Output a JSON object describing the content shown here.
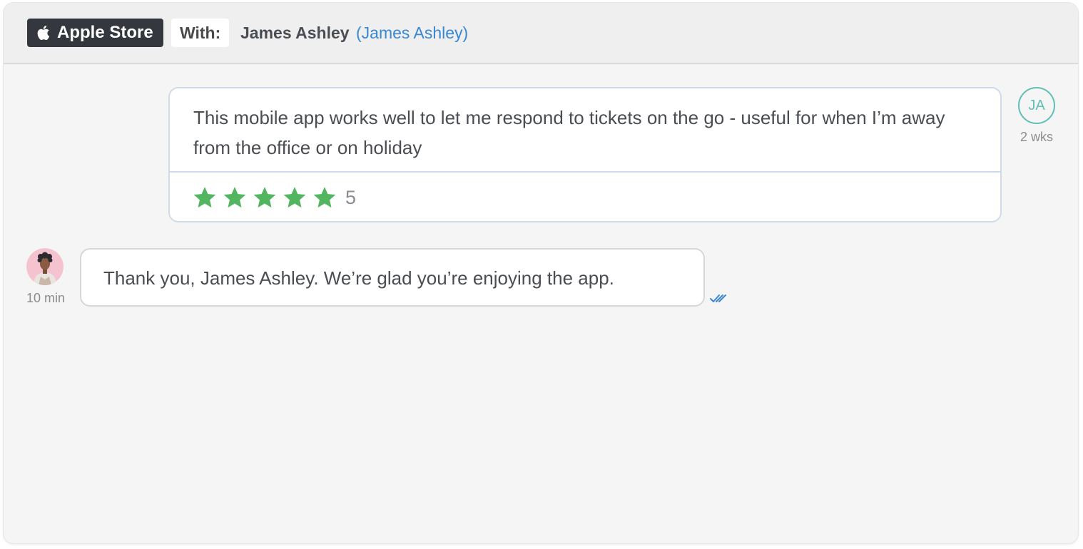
{
  "header": {
    "channel": {
      "label": "Apple Store",
      "icon": "apple-icon"
    },
    "with_label": "With:",
    "contact_name": "James Ashley",
    "contact_link": "(James Ashley)"
  },
  "conversation": {
    "incoming": {
      "text": "This mobile app works well to let me respond to tickets on the go - useful for when I’m away from the office or on holiday",
      "rating": {
        "stars": 5,
        "max": 5,
        "value_label": "5"
      },
      "avatar_initials": "JA",
      "time": "2 wks"
    },
    "reply": {
      "text": "Thank you, James Ashley. We’re glad you’re enjoying the app.",
      "time": "10 min",
      "status_icon": "double-check-icon"
    }
  },
  "colors": {
    "star": "#52b560",
    "link": "#3a87d4",
    "avatar_accent": "#5fbfb4",
    "badge_bg": "#34373d"
  }
}
